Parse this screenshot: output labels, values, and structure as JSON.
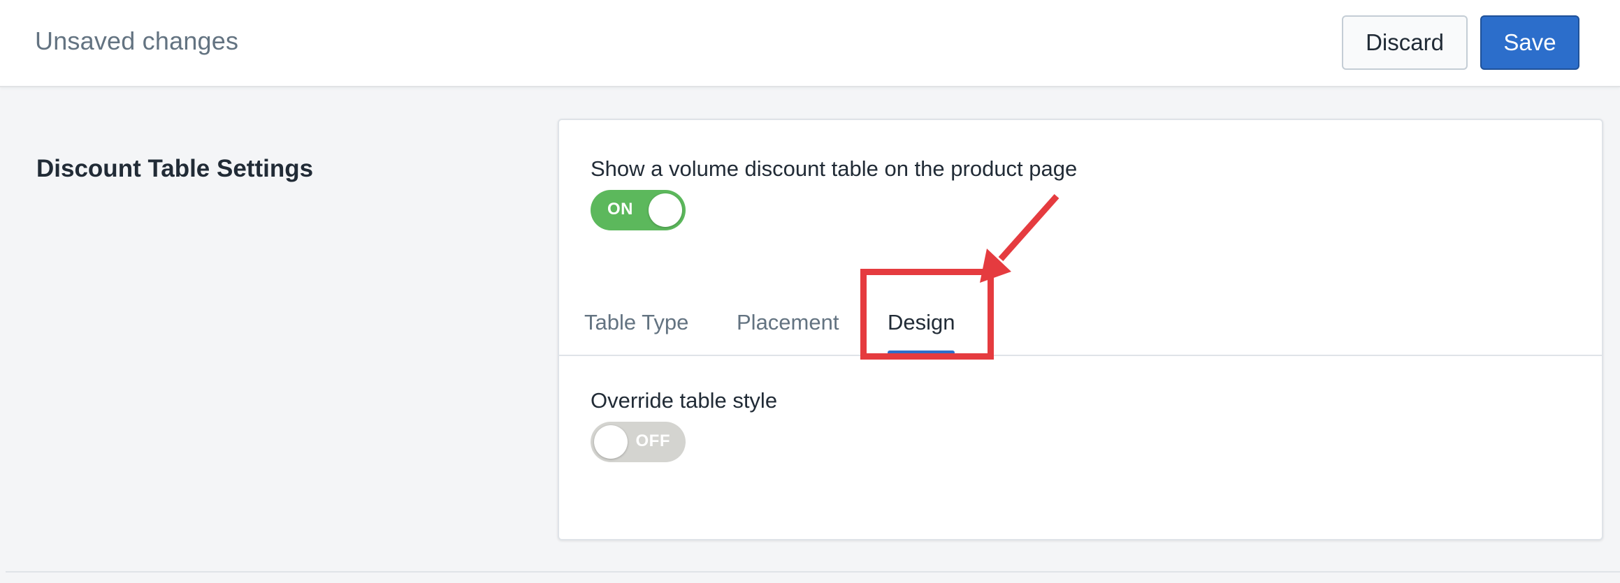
{
  "savebar": {
    "title": "Unsaved changes",
    "discard_label": "Discard",
    "save_label": "Save",
    "save_color": "#2c6ecb"
  },
  "section": {
    "title": "Discount Table Settings"
  },
  "card": {
    "show_table_label": "Show a volume discount table on the product page",
    "show_table_toggle": {
      "state": "ON",
      "color": "#5cb85c"
    },
    "tabs": [
      {
        "label": "Table Type",
        "selected": false
      },
      {
        "label": "Placement",
        "selected": false
      },
      {
        "label": "Design",
        "selected": true
      }
    ],
    "override_label": "Override table style",
    "override_toggle": {
      "state": "OFF",
      "color": "#d4d4d0"
    }
  },
  "annotation": {
    "color": "#e53b3f",
    "target": "Design"
  }
}
